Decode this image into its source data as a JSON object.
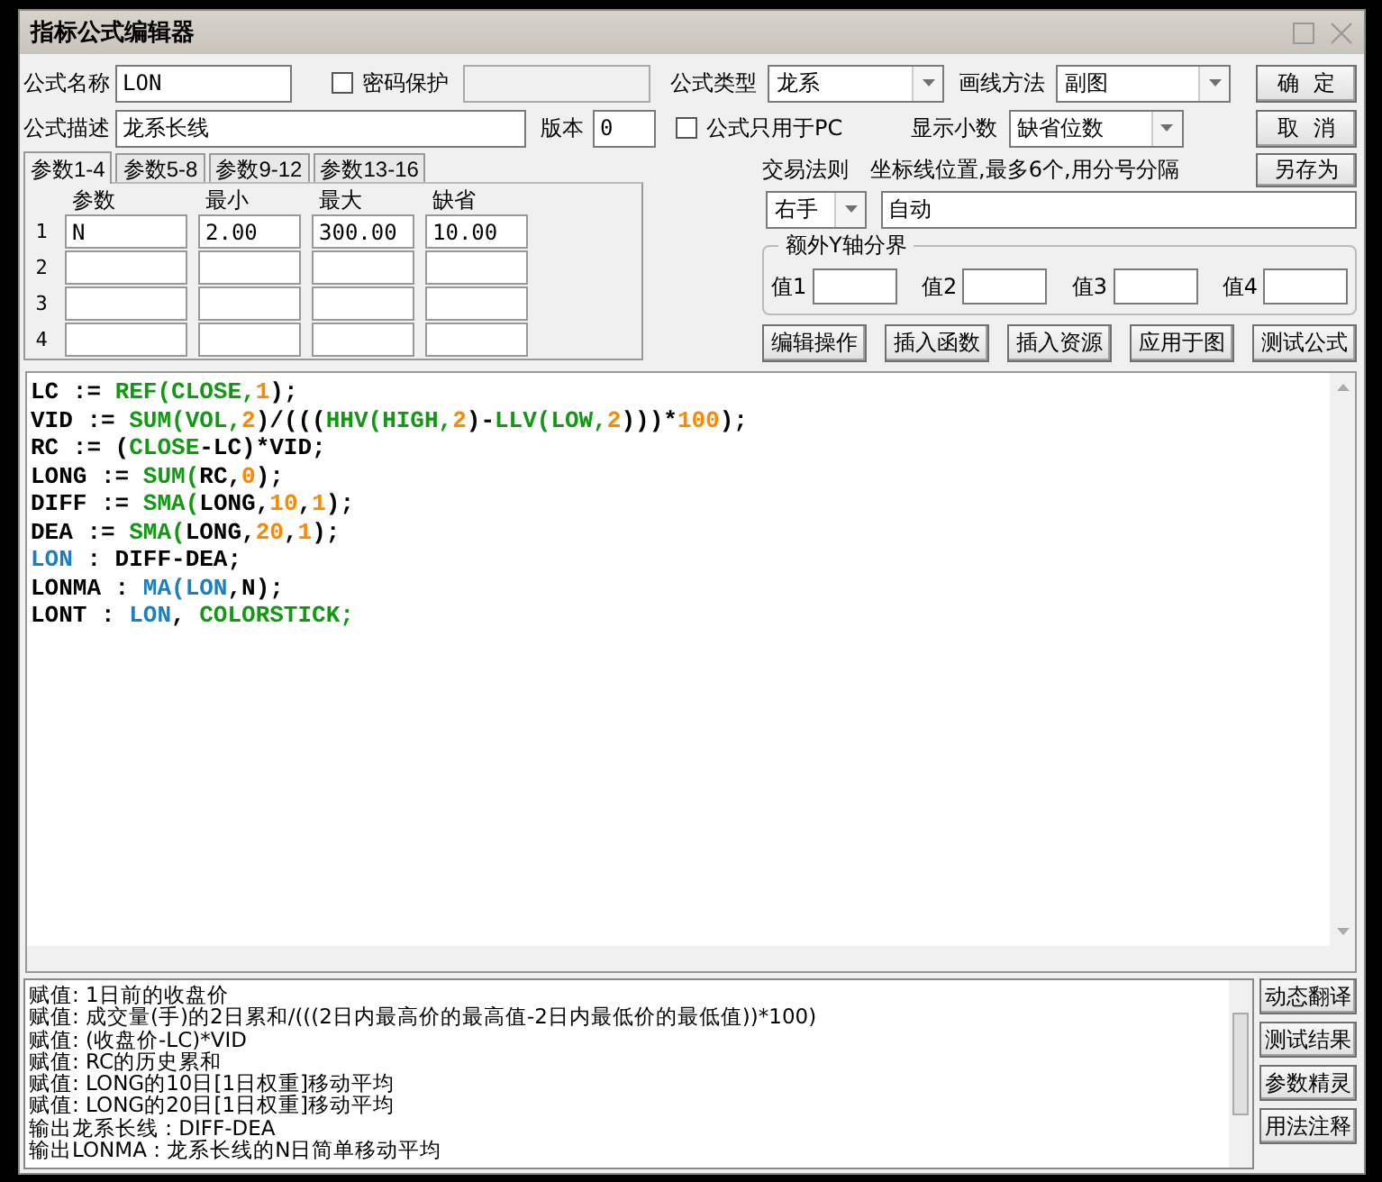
{
  "window": {
    "title": "指标公式编辑器"
  },
  "form": {
    "name_label": "公式名称",
    "name": "LON",
    "password": {
      "label": "密码保护",
      "checked": false
    },
    "type_label": "公式类型",
    "type": "龙系",
    "draw_label": "画线方法",
    "draw": "副图",
    "desc_label": "公式描述",
    "desc": "龙系长线",
    "version_label": "版本",
    "version": "0",
    "pc_only": {
      "label": "公式只用于PC",
      "checked": false
    },
    "decimals_label": "显示小数",
    "decimals": "缺省位数"
  },
  "side_buttons": [
    "确  定",
    "取  消",
    "另存为"
  ],
  "param_tabs": [
    {
      "label": "参数1-4",
      "selected": true
    },
    {
      "label": "参数5-8",
      "selected": false
    },
    {
      "label": "参数9-12",
      "selected": false
    },
    {
      "label": "参数13-16",
      "selected": false
    }
  ],
  "params": {
    "columns": [
      "参数",
      "最小",
      "最大",
      "缺省"
    ],
    "rows": [
      {
        "index": "1",
        "cells": [
          "N",
          "2.00",
          "300.00",
          "10.00"
        ]
      },
      {
        "index": "2"
      },
      {
        "index": "3"
      },
      {
        "index": "4"
      }
    ]
  },
  "trade_rule": {
    "label": "交易法则",
    "value": "右手"
  },
  "axis_lines": {
    "label": "坐标线位置,最多6个,用分号分隔",
    "value": "自动"
  },
  "y_bounds": {
    "title": "额外Y轴分界",
    "fields": [
      {
        "label": "值1"
      },
      {
        "label": "值2"
      },
      {
        "label": "值3"
      },
      {
        "label": "值4"
      }
    ]
  },
  "tool_buttons": [
    "编辑操作",
    "插入函数",
    "插入资源",
    "应用于图",
    "测试公式"
  ],
  "code": [
    [
      {
        "text": "LC := ",
        "kind": "plain"
      },
      {
        "text": "REF(CLOSE,",
        "kind": "func"
      },
      {
        "text": "1",
        "kind": "num"
      },
      {
        "text": ");",
        "kind": "plain"
      }
    ],
    [
      {
        "text": "VID := ",
        "kind": "plain"
      },
      {
        "text": "SUM(VOL,",
        "kind": "func"
      },
      {
        "text": "2",
        "kind": "num"
      },
      {
        "text": ")/(((",
        "kind": "plain"
      },
      {
        "text": "HHV(HIGH,",
        "kind": "func"
      },
      {
        "text": "2",
        "kind": "num"
      },
      {
        "text": ")-",
        "kind": "plain"
      },
      {
        "text": "LLV(LOW,",
        "kind": "func"
      },
      {
        "text": "2",
        "kind": "num"
      },
      {
        "text": ")))*",
        "kind": "plain"
      },
      {
        "text": "100",
        "kind": "num"
      },
      {
        "text": ");",
        "kind": "plain"
      }
    ],
    [
      {
        "text": "RC := (",
        "kind": "plain"
      },
      {
        "text": "CLOSE",
        "kind": "func"
      },
      {
        "text": "-LC)*VID;",
        "kind": "plain"
      }
    ],
    [
      {
        "text": "LONG := ",
        "kind": "plain"
      },
      {
        "text": "SUM(",
        "kind": "func"
      },
      {
        "text": "RC,",
        "kind": "plain"
      },
      {
        "text": "0",
        "kind": "num"
      },
      {
        "text": ");",
        "kind": "plain"
      }
    ],
    [
      {
        "text": "DIFF := ",
        "kind": "plain"
      },
      {
        "text": "SMA(",
        "kind": "func"
      },
      {
        "text": "LONG,",
        "kind": "plain"
      },
      {
        "text": "10",
        "kind": "num"
      },
      {
        "text": ",",
        "kind": "plain"
      },
      {
        "text": "1",
        "kind": "num"
      },
      {
        "text": ");",
        "kind": "plain"
      }
    ],
    [
      {
        "text": "DEA := ",
        "kind": "plain"
      },
      {
        "text": "SMA(",
        "kind": "func"
      },
      {
        "text": "LONG,",
        "kind": "plain"
      },
      {
        "text": "20",
        "kind": "num"
      },
      {
        "text": ",",
        "kind": "plain"
      },
      {
        "text": "1",
        "kind": "num"
      },
      {
        "text": ");",
        "kind": "plain"
      }
    ],
    [
      {
        "text": "LON",
        "kind": "var"
      },
      {
        "text": " : DIFF-DEA;",
        "kind": "plain"
      }
    ],
    [
      {
        "text": "LONMA : ",
        "kind": "plain"
      },
      {
        "text": "MA(LON",
        "kind": "var"
      },
      {
        "text": ",N);",
        "kind": "plain"
      }
    ],
    [
      {
        "text": "LONT : ",
        "kind": "plain"
      },
      {
        "text": "LON",
        "kind": "var"
      },
      {
        "text": ", ",
        "kind": "plain"
      },
      {
        "text": "COLORSTICK;",
        "kind": "func"
      }
    ]
  ],
  "explain": [
    "赋值: 1日前的收盘价",
    "赋值: 成交量(手)的2日累和/(((2日内最高价的最高值-2日内最低价的最低值))*100)",
    "赋值: (收盘价-LC)*VID",
    "赋值: RC的历史累和",
    "赋值: LONG的10日[1日权重]移动平均",
    "赋值: LONG的20日[1日权重]移动平均",
    "输出龙系长线 : DIFF-DEA",
    "输出LONMA : 龙系长线的N日简单移动平均"
  ],
  "explain_buttons": [
    "动态翻译",
    "测试结果",
    "参数精灵",
    "用法注释"
  ]
}
